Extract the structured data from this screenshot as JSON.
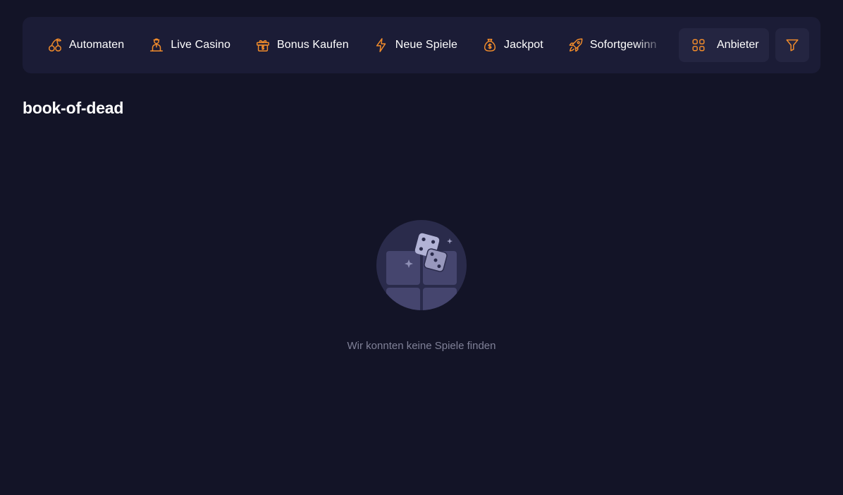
{
  "nav": {
    "items": [
      {
        "label": "Automaten",
        "icon": "cherries-icon"
      },
      {
        "label": "Live Casino",
        "icon": "dealer-icon"
      },
      {
        "label": "Bonus Kaufen",
        "icon": "gift-dollar-icon"
      },
      {
        "label": "Neue Spiele",
        "icon": "lightning-icon"
      },
      {
        "label": "Jackpot",
        "icon": "money-bag-icon"
      },
      {
        "label": "Sofortgewinn",
        "icon": "rocket-icon"
      }
    ],
    "provider_label": "Anbieter",
    "provider_icon": "grid-icon",
    "filter_icon": "filter-icon"
  },
  "page": {
    "title": "book-of-dead"
  },
  "empty_state": {
    "message": "Wir konnten keine Spiele finden",
    "illustration": "dice-icon"
  },
  "colors": {
    "background": "#131427",
    "nav_background": "#1b1c36",
    "button_background": "#242541",
    "accent": "#f28c2b",
    "muted_text": "#7f8097"
  }
}
